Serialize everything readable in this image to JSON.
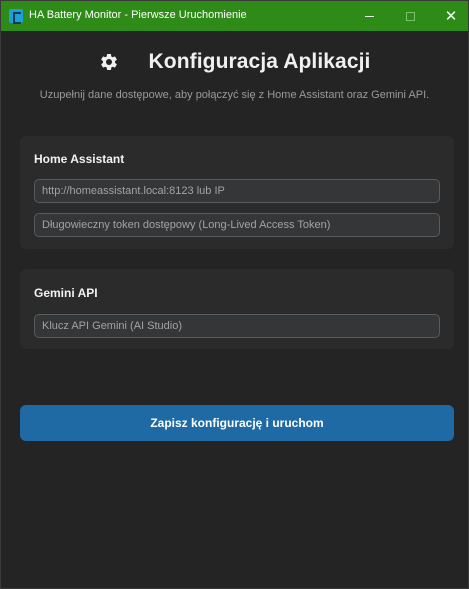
{
  "window": {
    "title": "HA Battery Monitor - Pierwsze Uruchomienie",
    "icon": "app-icon",
    "controls": {
      "minimize": "minimize-icon",
      "maximize": "maximize-icon",
      "close": "close-icon"
    },
    "titlebar_color": "#2e8b17"
  },
  "header": {
    "icon": "gear-icon",
    "title": "Konfiguracja Aplikacji",
    "subtitle": "Uzupełnij dane dostępowe, aby połączyć się z Home Assistant oraz Gemini API."
  },
  "sections": {
    "home_assistant": {
      "title": "Home Assistant",
      "url_placeholder": "http://homeassistant.local:8123 lub IP",
      "token_placeholder": "Długowieczny token dostępowy (Long-Lived Access Token)"
    },
    "gemini": {
      "title": "Gemini API",
      "key_placeholder": "Klucz API Gemini (AI Studio)"
    }
  },
  "actions": {
    "save_label": "Zapisz konfigurację i uruchom",
    "accent_color": "#1f6aa5"
  }
}
